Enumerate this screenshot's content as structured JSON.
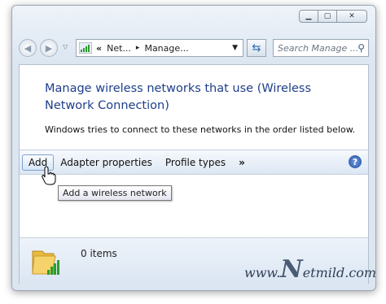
{
  "window": {
    "caption_buttons": [
      "minimize",
      "maximize",
      "close"
    ]
  },
  "navigation": {
    "back_icon": "back-arrow-icon",
    "forward_icon": "forward-arrow-icon",
    "address_prefix": "«",
    "address_segment1": "Net...",
    "address_separator": "▸",
    "address_segment2": "Manage...",
    "search_placeholder": "Search Manage ..."
  },
  "content": {
    "title": "Manage wireless networks that use (Wireless Network Connection)",
    "description": "Windows tries to connect to these networks in the order listed below."
  },
  "toolbar": {
    "add_label": "Add",
    "adapter_properties_label": "Adapter properties",
    "profile_types_label": "Profile types",
    "more_label": "»",
    "help_label": "?"
  },
  "tooltip": {
    "text": "Add a wireless network"
  },
  "status": {
    "count_text": "0 items"
  },
  "watermark": {
    "prefix": "www.",
    "letter": "N",
    "suffix": "etmild.com"
  },
  "colors": {
    "title_blue": "#1e3e8a",
    "accent_blue": "#2c64b4"
  }
}
